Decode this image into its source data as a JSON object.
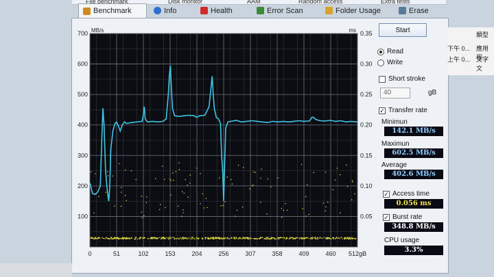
{
  "tabs": {
    "top": [
      "File benchmark",
      "Disk monitor",
      "AAM",
      "Random access",
      "Extra tests"
    ],
    "main": [
      {
        "label": "Benchmark",
        "icon": "benchmark-icon",
        "active": true
      },
      {
        "label": "Info",
        "icon": "info-icon"
      },
      {
        "label": "Health",
        "icon": "health-icon"
      },
      {
        "label": "Error Scan",
        "icon": "error-scan-icon"
      },
      {
        "label": "Folder Usage",
        "icon": "folder-icon"
      },
      {
        "label": "Erase",
        "icon": "erase-icon"
      }
    ]
  },
  "controls": {
    "start_label": "Start",
    "read_label": "Read",
    "write_label": "Write",
    "short_stroke_label": "Short stroke",
    "short_stroke_value": "40",
    "gb_unit": "gB",
    "transfer_rate_label": "Transfer rate",
    "minimum_label": "Minimun",
    "minimum_value": "142.1 MB/s",
    "maximum_label": "Maximun",
    "maximum_value": "602.5 MB/s",
    "average_label": "Average",
    "average_value": "402.6 MB/s",
    "access_time_label": "Access time",
    "access_time_value": "0.056 ms",
    "burst_rate_label": "Burst rate",
    "burst_rate_value": "348.8 MB/s",
    "cpu_usage_label": "CPU usage",
    "cpu_usage_value": "3.3%"
  },
  "background_app": {
    "header": "類型",
    "rows": [
      [
        "下午 0...",
        "應用程"
      ],
      [
        "上午 0...",
        "文字文"
      ]
    ]
  },
  "chart_data": {
    "type": "line",
    "left_axis_unit": "MB/s",
    "right_axis_unit": "ms",
    "x_unit": "gB",
    "x_ticks": [
      "0",
      "51",
      "102",
      "153",
      "204",
      "256",
      "307",
      "358",
      "409",
      "460",
      "512gB"
    ],
    "y_ticks_left": [
      "100",
      "200",
      "300",
      "400",
      "500",
      "600",
      "700"
    ],
    "y_ticks_right": [
      "0.05",
      "0.10",
      "0.15",
      "0.20",
      "0.25",
      "0.30",
      "0.35"
    ],
    "xlim": [
      0,
      512
    ],
    "ylim_left": [
      0,
      700
    ],
    "ylim_right": [
      0,
      0.35
    ],
    "colors": {
      "transfer": "#3fc6e6",
      "access": "#e8e23a",
      "grid": "#6e7582",
      "bg": "#0b0d13"
    },
    "transfer_rate": [
      [
        0,
        210
      ],
      [
        5,
        175
      ],
      [
        10,
        172
      ],
      [
        15,
        180
      ],
      [
        20,
        200
      ],
      [
        23,
        360
      ],
      [
        25,
        455
      ],
      [
        27,
        400
      ],
      [
        30,
        250
      ],
      [
        33,
        190
      ],
      [
        36,
        150
      ],
      [
        38,
        195
      ],
      [
        40,
        320
      ],
      [
        44,
        380
      ],
      [
        48,
        405
      ],
      [
        51,
        410
      ],
      [
        55,
        395
      ],
      [
        58,
        380
      ],
      [
        62,
        400
      ],
      [
        66,
        410
      ],
      [
        70,
        405
      ],
      [
        80,
        408
      ],
      [
        90,
        410
      ],
      [
        100,
        412
      ],
      [
        102,
        430
      ],
      [
        104,
        460
      ],
      [
        106,
        420
      ],
      [
        110,
        410
      ],
      [
        120,
        412
      ],
      [
        130,
        410
      ],
      [
        140,
        412
      ],
      [
        146,
        420
      ],
      [
        150,
        500
      ],
      [
        152,
        560
      ],
      [
        154,
        595
      ],
      [
        156,
        520
      ],
      [
        158,
        455
      ],
      [
        162,
        430
      ],
      [
        170,
        428
      ],
      [
        180,
        430
      ],
      [
        190,
        432
      ],
      [
        200,
        430
      ],
      [
        204,
        425
      ],
      [
        210,
        430
      ],
      [
        220,
        432
      ],
      [
        228,
        460
      ],
      [
        232,
        525
      ],
      [
        234,
        560
      ],
      [
        236,
        500
      ],
      [
        238,
        455
      ],
      [
        242,
        425
      ],
      [
        246,
        420
      ],
      [
        250,
        405
      ],
      [
        252,
        300
      ],
      [
        254,
        250
      ],
      [
        256,
        150
      ],
      [
        258,
        280
      ],
      [
        260,
        390
      ],
      [
        264,
        410
      ],
      [
        270,
        412
      ],
      [
        280,
        415
      ],
      [
        290,
        410
      ],
      [
        300,
        412
      ],
      [
        310,
        414
      ],
      [
        320,
        412
      ],
      [
        330,
        410
      ],
      [
        340,
        408
      ],
      [
        350,
        412
      ],
      [
        360,
        410
      ],
      [
        370,
        412
      ],
      [
        380,
        410
      ],
      [
        390,
        412
      ],
      [
        400,
        414
      ],
      [
        409,
        412
      ],
      [
        420,
        413
      ],
      [
        425,
        425
      ],
      [
        428,
        425
      ],
      [
        432,
        418
      ],
      [
        440,
        414
      ],
      [
        450,
        413
      ],
      [
        460,
        415
      ],
      [
        470,
        412
      ],
      [
        480,
        414
      ],
      [
        490,
        410
      ],
      [
        500,
        412
      ],
      [
        510,
        410
      ],
      [
        512,
        410
      ]
    ],
    "access_time_band_ms": [
      0.0135,
      0.0165
    ],
    "access_time_sparse_ms": [
      0.058,
      0.075,
      0.09,
      0.11,
      0.12,
      0.13
    ]
  }
}
